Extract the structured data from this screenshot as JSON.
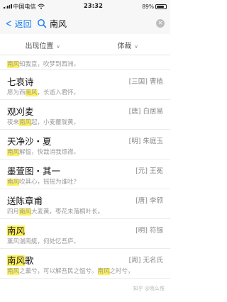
{
  "status": {
    "carrier": "中国电信",
    "time": "23:32",
    "battery": "89%"
  },
  "nav": {
    "back_label": "返回",
    "search_value": "南风"
  },
  "filters": {
    "position_label": "出现位置",
    "genre_label": "体裁"
  },
  "results": [
    {
      "title": "",
      "author": "",
      "snippet_parts": [
        [
          "南风",
          true
        ],
        [
          "知我意，吹梦到西洲。",
          false
        ]
      ]
    },
    {
      "title": "七哀诗",
      "author": "[三国] 曹植",
      "snippet_parts": [
        [
          "愿为西",
          false
        ],
        [
          "南风",
          true
        ],
        [
          "，长逝入君怀。",
          false
        ]
      ]
    },
    {
      "title": "观刈麦",
      "author": "[唐] 白居易",
      "snippet_parts": [
        [
          "夜来",
          false
        ],
        [
          "南风",
          true
        ],
        [
          "起，小麦覆陇黄。",
          false
        ]
      ]
    },
    {
      "title": "天净沙・夏",
      "author": "[明] 朱庭玉",
      "snippet_parts": [
        [
          "南风",
          true
        ],
        [
          "解愠，快哉消我烦襟。",
          false
        ]
      ]
    },
    {
      "title": "墨萱图・其一",
      "author": "[元] 王冕",
      "snippet_parts": [
        [
          "南风",
          true
        ],
        [
          "吹其心，摇摇为谁吐？",
          false
        ]
      ]
    },
    {
      "title": "送陈章甫",
      "author": "[唐] 李颀",
      "snippet_parts": [
        [
          "四月",
          false
        ],
        [
          "南风",
          true
        ],
        [
          "大麦黄，枣花未落桐叶长。",
          false
        ]
      ]
    },
    {
      "title": "南风",
      "title_highlight": true,
      "author": "[明] 符锡",
      "snippet_parts": [
        [
          "薰风湍南艇，何处忆吾庐。",
          false
        ]
      ]
    },
    {
      "title": "南风歌",
      "title_highlight": true,
      "title_hl_len": 2,
      "author": "[周] 无名氏",
      "snippet_parts": [
        [
          "南风",
          true
        ],
        [
          "之薰兮，可以解吾民之愠兮。",
          false
        ],
        [
          "南风",
          true
        ],
        [
          "之时兮，",
          false
        ]
      ]
    }
  ],
  "watermark": "知乎 @晓么惟",
  "colors": {
    "accent": "#1a7ef2",
    "highlight": "#fff25a"
  }
}
